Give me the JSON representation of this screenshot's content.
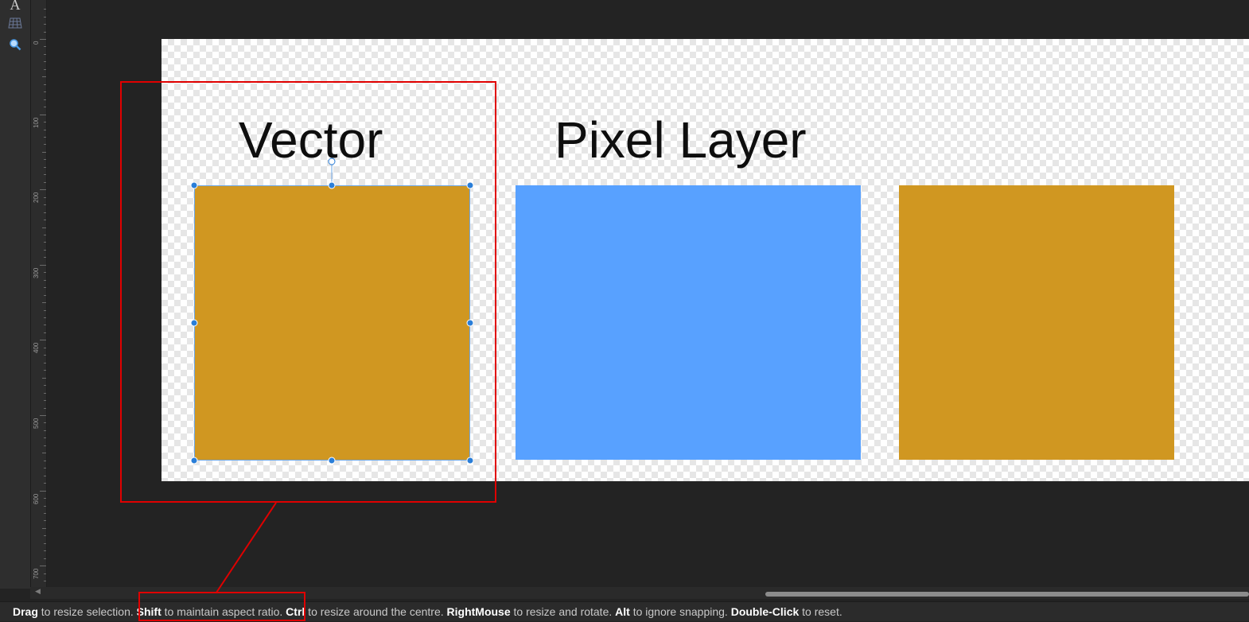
{
  "toolbar": {
    "tools": [
      {
        "icon": "text-tool-icon",
        "glyph": "A"
      },
      {
        "icon": "mesh-warp-tool-icon",
        "glyph": "▦"
      },
      {
        "icon": "zoom-tool-icon",
        "glyph": "🔍"
      }
    ]
  },
  "ruler": {
    "labels": [
      "0",
      "100",
      "200",
      "300",
      "400",
      "500",
      "600",
      "700"
    ]
  },
  "canvas": {
    "titles": {
      "vector": "Vector",
      "pixel_layer": "Pixel Layer"
    },
    "shapes": [
      {
        "name": "vector-rectangle",
        "color": "#D09721",
        "selected": true
      },
      {
        "name": "pixel-rectangle-blue",
        "color": "#58A1FF",
        "selected": false
      },
      {
        "name": "pixel-rectangle-gold",
        "color": "#D09721",
        "selected": false
      }
    ],
    "selection_color": "#2A7ED8",
    "annotation_color": "#E00000"
  },
  "statusbar": {
    "parts": [
      {
        "key": "Drag",
        "text": " to resize selection. "
      },
      {
        "key": "Shift",
        "text": " to maintain aspect ratio. "
      },
      {
        "key": "Ctrl",
        "text": " to resize around the centre. "
      },
      {
        "key": "RightMouse",
        "text": " to resize and rotate. "
      },
      {
        "key": "Alt",
        "text": " to ignore snapping. "
      },
      {
        "key": "Double-Click",
        "text": " to reset."
      }
    ]
  }
}
